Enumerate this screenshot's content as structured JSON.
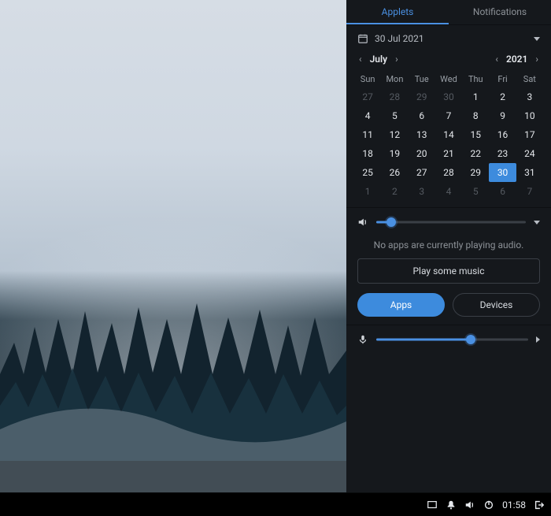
{
  "tabs": {
    "applets": "Applets",
    "notifications": "Notifications",
    "active": "applets"
  },
  "date": {
    "display": "30 Jul 2021"
  },
  "calendar": {
    "month_label": "July",
    "year_label": "2021",
    "dow": [
      "Sun",
      "Mon",
      "Tue",
      "Wed",
      "Thu",
      "Fri",
      "Sat"
    ],
    "weeks": [
      [
        {
          "n": 27,
          "muted": true
        },
        {
          "n": 28,
          "muted": true
        },
        {
          "n": 29,
          "muted": true
        },
        {
          "n": 30,
          "muted": true
        },
        {
          "n": 1
        },
        {
          "n": 2
        },
        {
          "n": 3
        }
      ],
      [
        {
          "n": 4
        },
        {
          "n": 5
        },
        {
          "n": 6
        },
        {
          "n": 7
        },
        {
          "n": 8
        },
        {
          "n": 9
        },
        {
          "n": 10
        }
      ],
      [
        {
          "n": 11
        },
        {
          "n": 12
        },
        {
          "n": 13
        },
        {
          "n": 14
        },
        {
          "n": 15
        },
        {
          "n": 16
        },
        {
          "n": 17
        }
      ],
      [
        {
          "n": 18
        },
        {
          "n": 19
        },
        {
          "n": 20
        },
        {
          "n": 21
        },
        {
          "n": 22
        },
        {
          "n": 23
        },
        {
          "n": 24
        }
      ],
      [
        {
          "n": 25
        },
        {
          "n": 26
        },
        {
          "n": 27
        },
        {
          "n": 28
        },
        {
          "n": 29
        },
        {
          "n": 30,
          "selected": true
        },
        {
          "n": 31
        }
      ],
      [
        {
          "n": 1,
          "muted": true
        },
        {
          "n": 2,
          "muted": true
        },
        {
          "n": 3,
          "muted": true
        },
        {
          "n": 4,
          "muted": true
        },
        {
          "n": 5,
          "muted": true
        },
        {
          "n": 6,
          "muted": true
        },
        {
          "n": 7,
          "muted": true
        }
      ]
    ]
  },
  "volume": {
    "percent": 10
  },
  "audio": {
    "no_apps": "No apps are currently playing audio.",
    "play_label": "Play some music",
    "apps_label": "Apps",
    "devices_label": "Devices"
  },
  "mic": {
    "percent": 62
  },
  "taskbar": {
    "clock": "01:58"
  }
}
